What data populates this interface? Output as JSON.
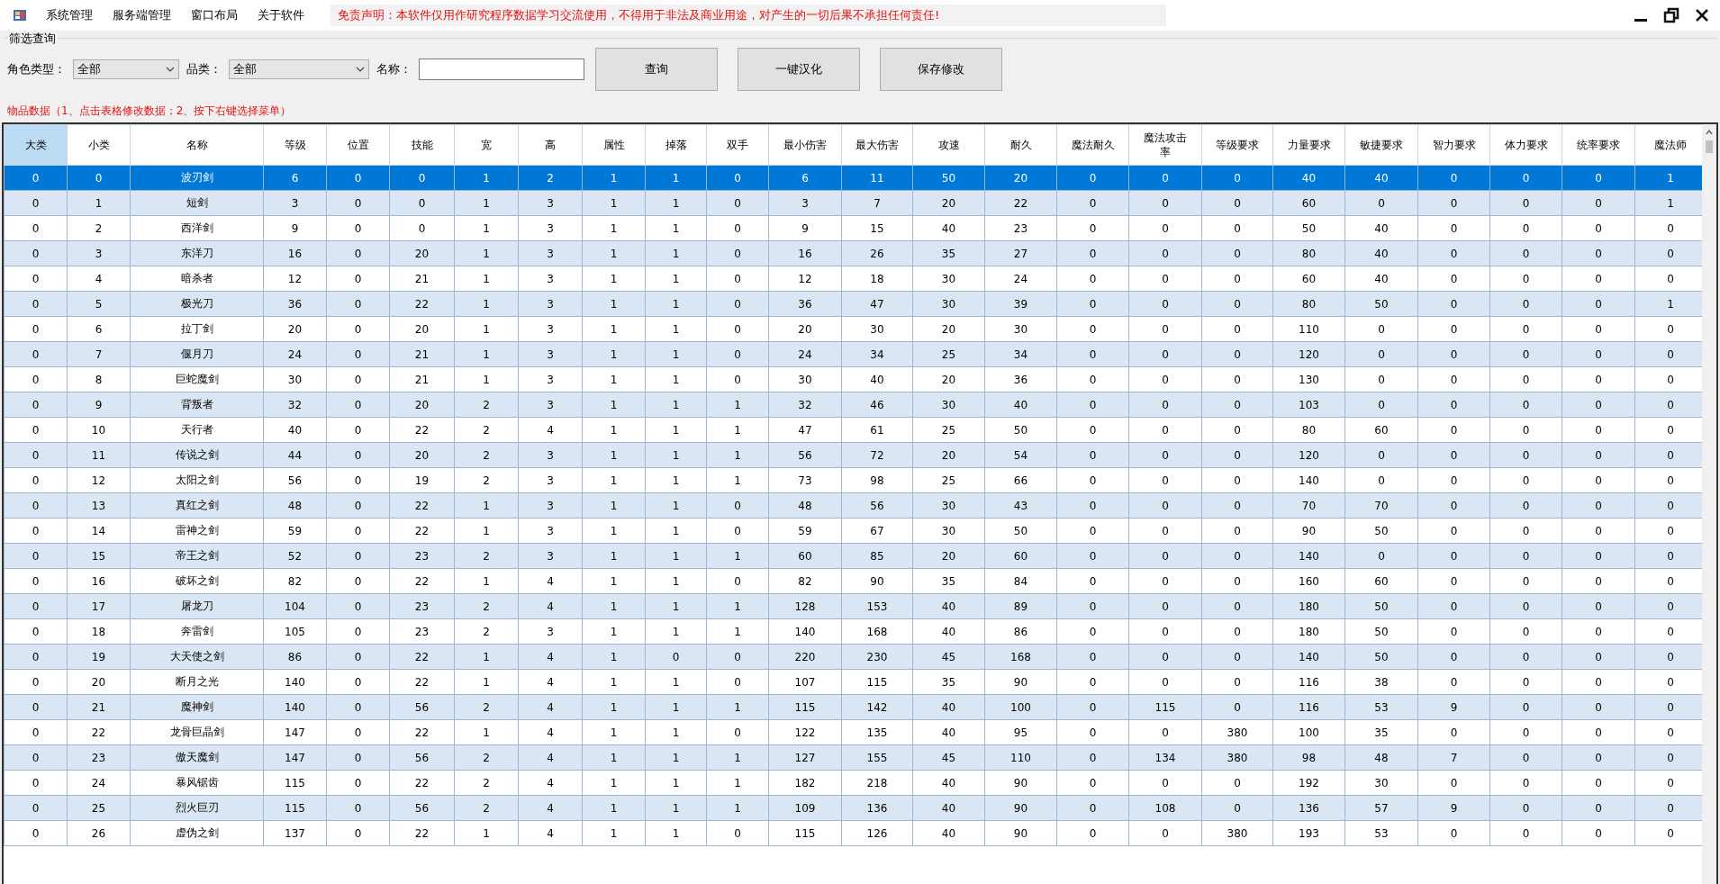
{
  "menu": [
    "系统管理",
    "服务端管理",
    "窗口布局",
    "关于软件"
  ],
  "disclaimer": "免责声明：本软件仅用作研究程序数据学习交流使用，不得用于非法及商业用途，对产生的一切后果不承担任何责任!",
  "filter_group": {
    "title": "筛选查询",
    "dropdowns": [
      {
        "label": "角色类型：",
        "value": "全部"
      },
      {
        "label": "品类：",
        "value": "全部"
      }
    ],
    "name_field": {
      "label": "名称："
    },
    "buttons": [
      "查询",
      "一键汉化",
      "保存修改"
    ]
  },
  "table_caption": "物品数据（1、点击表格修改数据；2、按下右键选择菜单）",
  "table": {
    "columns": [
      {
        "label": "大类",
        "selected": true
      },
      {
        "label": "小类",
        "selected": false
      },
      {
        "label": "名称",
        "selected": false
      },
      {
        "label": "等级",
        "selected": false
      },
      {
        "label": "位置",
        "selected": false
      },
      {
        "label": "技能",
        "selected": false
      },
      {
        "label": "宽",
        "selected": false
      },
      {
        "label": "高",
        "selected": false
      },
      {
        "label": "属性",
        "selected": false
      },
      {
        "label": "掉落",
        "selected": false
      },
      {
        "label": "双手",
        "selected": false
      },
      {
        "label": "最小伤害",
        "selected": false
      },
      {
        "label": "最大伤害",
        "selected": false
      },
      {
        "label": "攻速",
        "selected": false
      },
      {
        "label": "耐久",
        "selected": false
      },
      {
        "label": "魔法耐久",
        "selected": false
      },
      {
        "label": "魔法攻击率",
        "selected": false
      },
      {
        "label": "等级要求",
        "selected": false
      },
      {
        "label": "力量要求",
        "selected": false
      },
      {
        "label": "敏捷要求",
        "selected": false
      },
      {
        "label": "智力要求",
        "selected": false
      },
      {
        "label": "体力要求",
        "selected": false
      },
      {
        "label": "统率要求",
        "selected": false
      },
      {
        "label": "魔法师",
        "selected": false
      }
    ],
    "rows": [
      {
        "selected": true,
        "cells": [
          "0",
          "0",
          "波刃剑",
          "6",
          "0",
          "0",
          "1",
          "2",
          "1",
          "1",
          "0",
          "6",
          "11",
          "50",
          "20",
          "0",
          "0",
          "0",
          "40",
          "40",
          "0",
          "0",
          "0",
          "1"
        ]
      },
      {
        "selected": false,
        "cells": [
          "0",
          "1",
          "短剑",
          "3",
          "0",
          "0",
          "1",
          "3",
          "1",
          "1",
          "0",
          "3",
          "7",
          "20",
          "22",
          "0",
          "0",
          "0",
          "60",
          "0",
          "0",
          "0",
          "0",
          "1"
        ]
      },
      {
        "selected": false,
        "cells": [
          "0",
          "2",
          "西洋剑",
          "9",
          "0",
          "0",
          "1",
          "3",
          "1",
          "1",
          "0",
          "9",
          "15",
          "40",
          "23",
          "0",
          "0",
          "0",
          "50",
          "40",
          "0",
          "0",
          "0",
          "0"
        ]
      },
      {
        "selected": false,
        "cells": [
          "0",
          "3",
          "东洋刀",
          "16",
          "0",
          "20",
          "1",
          "3",
          "1",
          "1",
          "0",
          "16",
          "26",
          "35",
          "27",
          "0",
          "0",
          "0",
          "80",
          "40",
          "0",
          "0",
          "0",
          "0"
        ]
      },
      {
        "selected": false,
        "cells": [
          "0",
          "4",
          "暗杀者",
          "12",
          "0",
          "21",
          "1",
          "3",
          "1",
          "1",
          "0",
          "12",
          "18",
          "30",
          "24",
          "0",
          "0",
          "0",
          "60",
          "40",
          "0",
          "0",
          "0",
          "0"
        ]
      },
      {
        "selected": false,
        "cells": [
          "0",
          "5",
          "极光刀",
          "36",
          "0",
          "22",
          "1",
          "3",
          "1",
          "1",
          "0",
          "36",
          "47",
          "30",
          "39",
          "0",
          "0",
          "0",
          "80",
          "50",
          "0",
          "0",
          "0",
          "1"
        ]
      },
      {
        "selected": false,
        "cells": [
          "0",
          "6",
          "拉丁剑",
          "20",
          "0",
          "20",
          "1",
          "3",
          "1",
          "1",
          "0",
          "20",
          "30",
          "20",
          "30",
          "0",
          "0",
          "0",
          "110",
          "0",
          "0",
          "0",
          "0",
          "0"
        ]
      },
      {
        "selected": false,
        "cells": [
          "0",
          "7",
          "偃月刀",
          "24",
          "0",
          "21",
          "1",
          "3",
          "1",
          "1",
          "0",
          "24",
          "34",
          "25",
          "34",
          "0",
          "0",
          "0",
          "120",
          "0",
          "0",
          "0",
          "0",
          "0"
        ]
      },
      {
        "selected": false,
        "cells": [
          "0",
          "8",
          "巨蛇魔剑",
          "30",
          "0",
          "21",
          "1",
          "3",
          "1",
          "1",
          "0",
          "30",
          "40",
          "20",
          "36",
          "0",
          "0",
          "0",
          "130",
          "0",
          "0",
          "0",
          "0",
          "0"
        ]
      },
      {
        "selected": false,
        "cells": [
          "0",
          "9",
          "背叛者",
          "32",
          "0",
          "20",
          "2",
          "3",
          "1",
          "1",
          "1",
          "32",
          "46",
          "30",
          "40",
          "0",
          "0",
          "0",
          "103",
          "0",
          "0",
          "0",
          "0",
          "0"
        ]
      },
      {
        "selected": false,
        "cells": [
          "0",
          "10",
          "天行者",
          "40",
          "0",
          "22",
          "2",
          "4",
          "1",
          "1",
          "1",
          "47",
          "61",
          "25",
          "50",
          "0",
          "0",
          "0",
          "80",
          "60",
          "0",
          "0",
          "0",
          "0"
        ]
      },
      {
        "selected": false,
        "cells": [
          "0",
          "11",
          "传说之剑",
          "44",
          "0",
          "20",
          "2",
          "3",
          "1",
          "1",
          "1",
          "56",
          "72",
          "20",
          "54",
          "0",
          "0",
          "0",
          "120",
          "0",
          "0",
          "0",
          "0",
          "0"
        ]
      },
      {
        "selected": false,
        "cells": [
          "0",
          "12",
          "太阳之剑",
          "56",
          "0",
          "19",
          "2",
          "3",
          "1",
          "1",
          "1",
          "73",
          "98",
          "25",
          "66",
          "0",
          "0",
          "0",
          "140",
          "0",
          "0",
          "0",
          "0",
          "0"
        ]
      },
      {
        "selected": false,
        "cells": [
          "0",
          "13",
          "真红之剑",
          "48",
          "0",
          "22",
          "1",
          "3",
          "1",
          "1",
          "0",
          "48",
          "56",
          "30",
          "43",
          "0",
          "0",
          "0",
          "70",
          "70",
          "0",
          "0",
          "0",
          "0"
        ]
      },
      {
        "selected": false,
        "cells": [
          "0",
          "14",
          "雷神之剑",
          "59",
          "0",
          "22",
          "1",
          "3",
          "1",
          "1",
          "0",
          "59",
          "67",
          "30",
          "50",
          "0",
          "0",
          "0",
          "90",
          "50",
          "0",
          "0",
          "0",
          "0"
        ]
      },
      {
        "selected": false,
        "cells": [
          "0",
          "15",
          "帝王之剑",
          "52",
          "0",
          "23",
          "2",
          "3",
          "1",
          "1",
          "1",
          "60",
          "85",
          "20",
          "60",
          "0",
          "0",
          "0",
          "140",
          "0",
          "0",
          "0",
          "0",
          "0"
        ]
      },
      {
        "selected": false,
        "cells": [
          "0",
          "16",
          "破坏之剑",
          "82",
          "0",
          "22",
          "1",
          "4",
          "1",
          "1",
          "0",
          "82",
          "90",
          "35",
          "84",
          "0",
          "0",
          "0",
          "160",
          "60",
          "0",
          "0",
          "0",
          "0"
        ]
      },
      {
        "selected": false,
        "cells": [
          "0",
          "17",
          "屠龙刀",
          "104",
          "0",
          "23",
          "2",
          "4",
          "1",
          "1",
          "1",
          "128",
          "153",
          "40",
          "89",
          "0",
          "0",
          "0",
          "180",
          "50",
          "0",
          "0",
          "0",
          "0"
        ]
      },
      {
        "selected": false,
        "cells": [
          "0",
          "18",
          "奔雷剑",
          "105",
          "0",
          "23",
          "2",
          "3",
          "1",
          "1",
          "1",
          "140",
          "168",
          "40",
          "86",
          "0",
          "0",
          "0",
          "180",
          "50",
          "0",
          "0",
          "0",
          "0"
        ]
      },
      {
        "selected": false,
        "cells": [
          "0",
          "19",
          "大天使之剑",
          "86",
          "0",
          "22",
          "1",
          "4",
          "1",
          "0",
          "0",
          "220",
          "230",
          "45",
          "168",
          "0",
          "0",
          "0",
          "140",
          "50",
          "0",
          "0",
          "0",
          "0"
        ]
      },
      {
        "selected": false,
        "cells": [
          "0",
          "20",
          "断月之光",
          "140",
          "0",
          "22",
          "1",
          "4",
          "1",
          "1",
          "0",
          "107",
          "115",
          "35",
          "90",
          "0",
          "0",
          "0",
          "116",
          "38",
          "0",
          "0",
          "0",
          "0"
        ]
      },
      {
        "selected": false,
        "cells": [
          "0",
          "21",
          "魔神剑",
          "140",
          "0",
          "56",
          "2",
          "4",
          "1",
          "1",
          "1",
          "115",
          "142",
          "40",
          "100",
          "0",
          "115",
          "0",
          "116",
          "53",
          "9",
          "0",
          "0",
          "0"
        ]
      },
      {
        "selected": false,
        "cells": [
          "0",
          "22",
          "龙骨巨晶剑",
          "147",
          "0",
          "22",
          "1",
          "4",
          "1",
          "1",
          "0",
          "122",
          "135",
          "40",
          "95",
          "0",
          "0",
          "380",
          "100",
          "35",
          "0",
          "0",
          "0",
          "0"
        ]
      },
      {
        "selected": false,
        "cells": [
          "0",
          "23",
          "傲天魔剑",
          "147",
          "0",
          "56",
          "2",
          "4",
          "1",
          "1",
          "1",
          "127",
          "155",
          "45",
          "110",
          "0",
          "134",
          "380",
          "98",
          "48",
          "7",
          "0",
          "0",
          "0"
        ]
      },
      {
        "selected": false,
        "cells": [
          "0",
          "24",
          "暴风锯齿",
          "115",
          "0",
          "22",
          "2",
          "4",
          "1",
          "1",
          "1",
          "182",
          "218",
          "40",
          "90",
          "0",
          "0",
          "0",
          "192",
          "30",
          "0",
          "0",
          "0",
          "0"
        ]
      },
      {
        "selected": false,
        "cells": [
          "0",
          "25",
          "烈火巨刃",
          "115",
          "0",
          "56",
          "2",
          "4",
          "1",
          "1",
          "1",
          "109",
          "136",
          "40",
          "90",
          "0",
          "108",
          "0",
          "136",
          "57",
          "9",
          "0",
          "0",
          "0"
        ]
      },
      {
        "selected": false,
        "cells": [
          "0",
          "26",
          "虚伪之剑",
          "137",
          "0",
          "22",
          "1",
          "4",
          "1",
          "1",
          "0",
          "115",
          "126",
          "40",
          "90",
          "0",
          "0",
          "380",
          "193",
          "53",
          "0",
          "0",
          "0",
          "0"
        ]
      }
    ]
  }
}
